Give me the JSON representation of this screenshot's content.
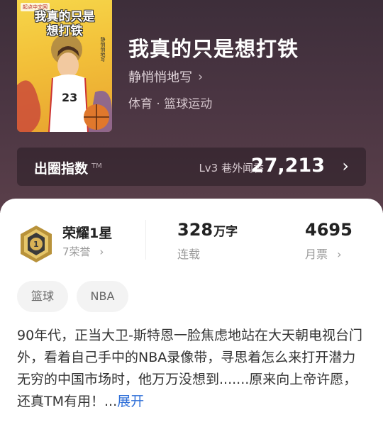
{
  "cover": {
    "badge": "起点中文网",
    "title_line1": "我真的只是",
    "title_line2": "想打铁",
    "author_vertical": "静悄悄地写",
    "jersey": "23"
  },
  "book": {
    "title": "我真的只是想打铁",
    "author": "静悄悄地写",
    "category": "体育 · 篮球运动"
  },
  "index": {
    "label": "出圈指数",
    "tm": "TM",
    "level": "Lv3 巷外闻香",
    "value": "27,213"
  },
  "honor": {
    "title": "荣耀1星",
    "sub": "7荣誉",
    "medal_number": "1"
  },
  "stats": {
    "words_num": "328",
    "words_unit": "万字",
    "words_label": "连载",
    "votes_num": "4695",
    "votes_label": "月票"
  },
  "tags": [
    "篮球",
    "NBA"
  ],
  "synopsis": {
    "text": "90年代，正当大卫-斯特恩一脸焦虑地站在大天朝电视台门外，看着自己手中的NBA录像带，寻思着怎么来打开潜力无穷的中国市场时，他万万没想到.......原来向上帝许愿，还真TM有用！...",
    "expand": "展开"
  },
  "icons": {
    "chevron": "chevron-right-icon",
    "medal": "medal-icon"
  },
  "colors": {
    "header_bg": "#4a3542",
    "link": "#2f6fd8",
    "medal_gold": "#c9a54a"
  }
}
